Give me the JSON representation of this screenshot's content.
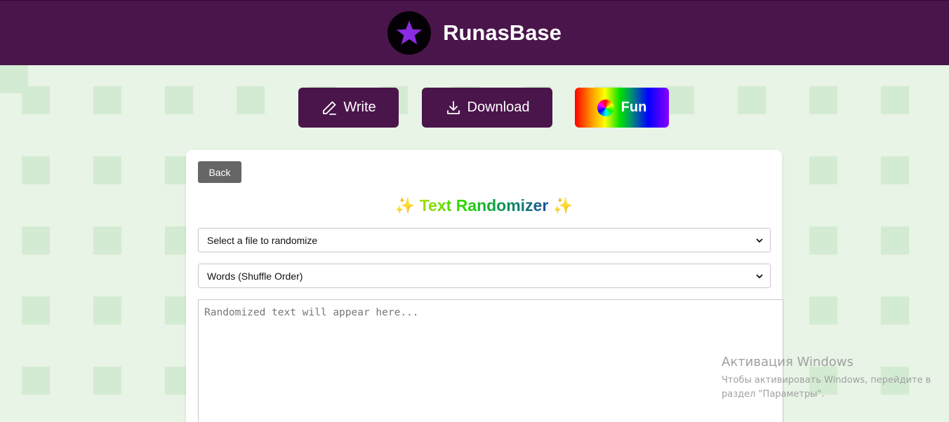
{
  "header": {
    "title": "RunasBase",
    "logo_icon": "star-icon"
  },
  "nav": {
    "write_label": "Write",
    "download_label": "Download",
    "fun_label": "Fun"
  },
  "card": {
    "back_label": "Back",
    "title_prefix": "✨",
    "title": "Text Randomizer",
    "title_suffix": "✨",
    "file_select_value": "Select a file to randomize",
    "mode_select_value": "Words (Shuffle Order)",
    "output_placeholder": "Randomized text will appear here..."
  },
  "watermark": {
    "title": "Активация Windows",
    "line1": "Чтобы активировать Windows, перейдите в",
    "line2": "раздел \"Параметры\"."
  },
  "colors": {
    "header_bg": "#4a154b",
    "page_bg": "#e8f4e6",
    "back_button_bg": "#666666",
    "accent_star": "#8a2be2"
  }
}
